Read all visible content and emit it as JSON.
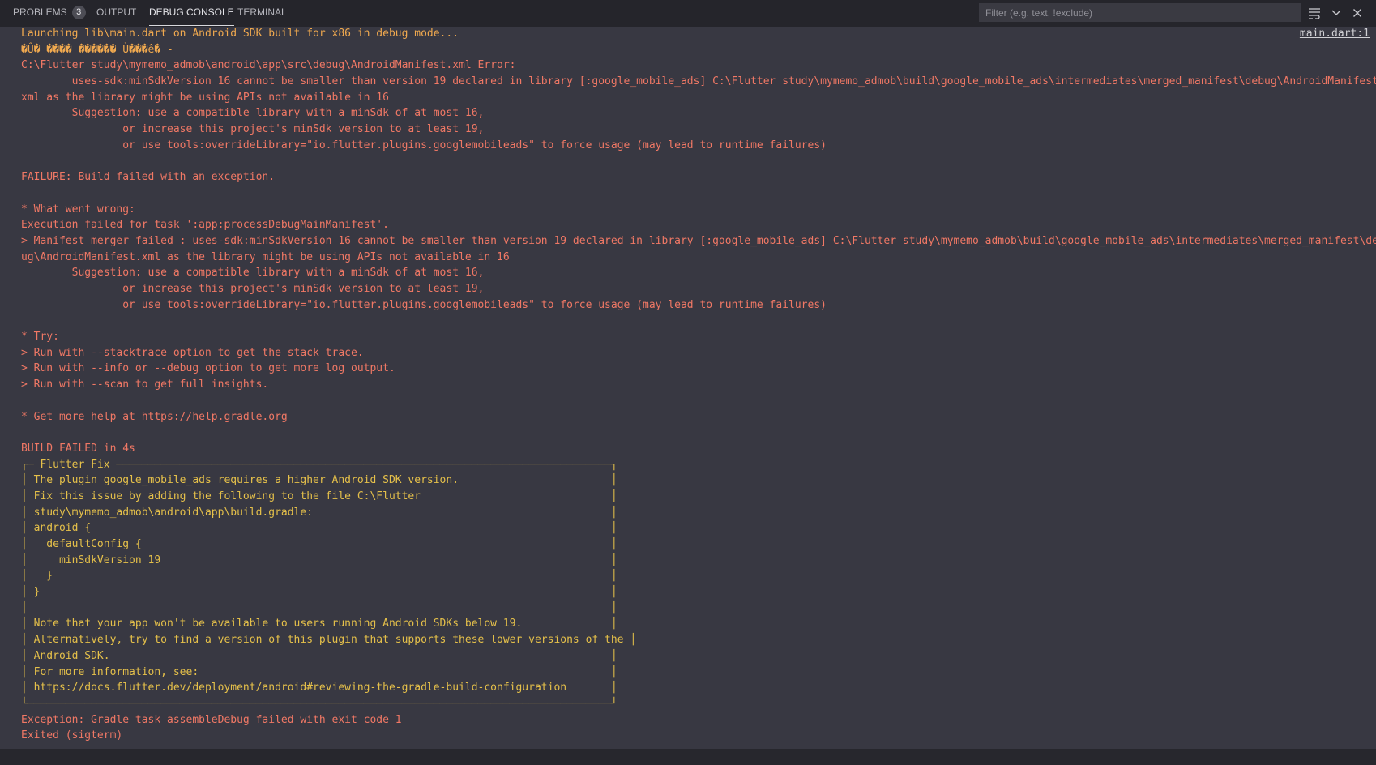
{
  "tabs": {
    "problems": "PROBLEMS",
    "problems_count": "3",
    "output": "OUTPUT",
    "debug_console": "DEBUG CONSOLE",
    "terminal": "TERMINAL"
  },
  "filter": {
    "placeholder": "Filter (e.g. text, !exclude)"
  },
  "icons": {
    "wrap": "word-wrap-icon",
    "chevron": "chevron-down-icon",
    "close": "close-icon"
  },
  "source_link": "main.dart:1",
  "colors": {
    "background": "#383842",
    "panel_bar": "#25252b",
    "launch_text": "#f0a94f",
    "error_text": "#f07865",
    "flutter_fix_text": "#e5c04a"
  },
  "console": {
    "lines": [
      "Launching lib\\main.dart on Android SDK built for x86 in debug mode...",
      "�Û� ���� ������ Ù���ê� -",
      "C:\\Flutter study\\mymemo_admob\\android\\app\\src\\debug\\AndroidManifest.xml Error:",
      "        uses-sdk:minSdkVersion 16 cannot be smaller than version 19 declared in library [:google_mobile_ads] C:\\Flutter study\\mymemo_admob\\build\\google_mobile_ads\\intermediates\\merged_manifest\\debug\\AndroidManifest.",
      "xml as the library might be using APIs not available in 16",
      "        Suggestion: use a compatible library with a minSdk of at most 16,",
      "                or increase this project's minSdk version to at least 19,",
      "                or use tools:overrideLibrary=\"io.flutter.plugins.googlemobileads\" to force usage (may lead to runtime failures)",
      "",
      "FAILURE: Build failed with an exception.",
      "",
      "* What went wrong:",
      "Execution failed for task ':app:processDebugMainManifest'.",
      "> Manifest merger failed : uses-sdk:minSdkVersion 16 cannot be smaller than version 19 declared in library [:google_mobile_ads] C:\\Flutter study\\mymemo_admob\\build\\google_mobile_ads\\intermediates\\merged_manifest\\deb",
      "ug\\AndroidManifest.xml as the library might be using APIs not available in 16",
      "        Suggestion: use a compatible library with a minSdk of at most 16,",
      "                or increase this project's minSdk version to at least 19,",
      "                or use tools:overrideLibrary=\"io.flutter.plugins.googlemobileads\" to force usage (may lead to runtime failures)",
      "",
      "* Try:",
      "> Run with --stacktrace option to get the stack trace.",
      "> Run with --info or --debug option to get more log output.",
      "> Run with --scan to get full insights.",
      "",
      "* Get more help at https://help.gradle.org",
      "",
      "BUILD FAILED in 4s",
      "┌─ Flutter Fix ──────────────────────────────────────────────────────────────────────────────┐",
      "│ The plugin google_mobile_ads requires a higher Android SDK version.                        │",
      "│ Fix this issue by adding the following to the file C:\\Flutter                              │",
      "│ study\\mymemo_admob\\android\\app\\build.gradle:                                               │",
      "│ android {                                                                                  │",
      "│   defaultConfig {                                                                          │",
      "│     minSdkVersion 19                                                                       │",
      "│   }                                                                                        │",
      "│ }                                                                                          │",
      "│                                                                                            │",
      "│ Note that your app won't be available to users running Android SDKs below 19.              │",
      "│ Alternatively, try to find a version of this plugin that supports these lower versions of the │",
      "│ Android SDK.                                                                               │",
      "│ For more information, see:                                                                 │",
      "│ https://docs.flutter.dev/deployment/android#reviewing-the-gradle-build-configuration       │",
      "└────────────────────────────────────────────────────────────────────────────────────────────┘",
      "Exception: Gradle task assembleDebug failed with exit code 1",
      "Exited (sigterm)"
    ]
  }
}
